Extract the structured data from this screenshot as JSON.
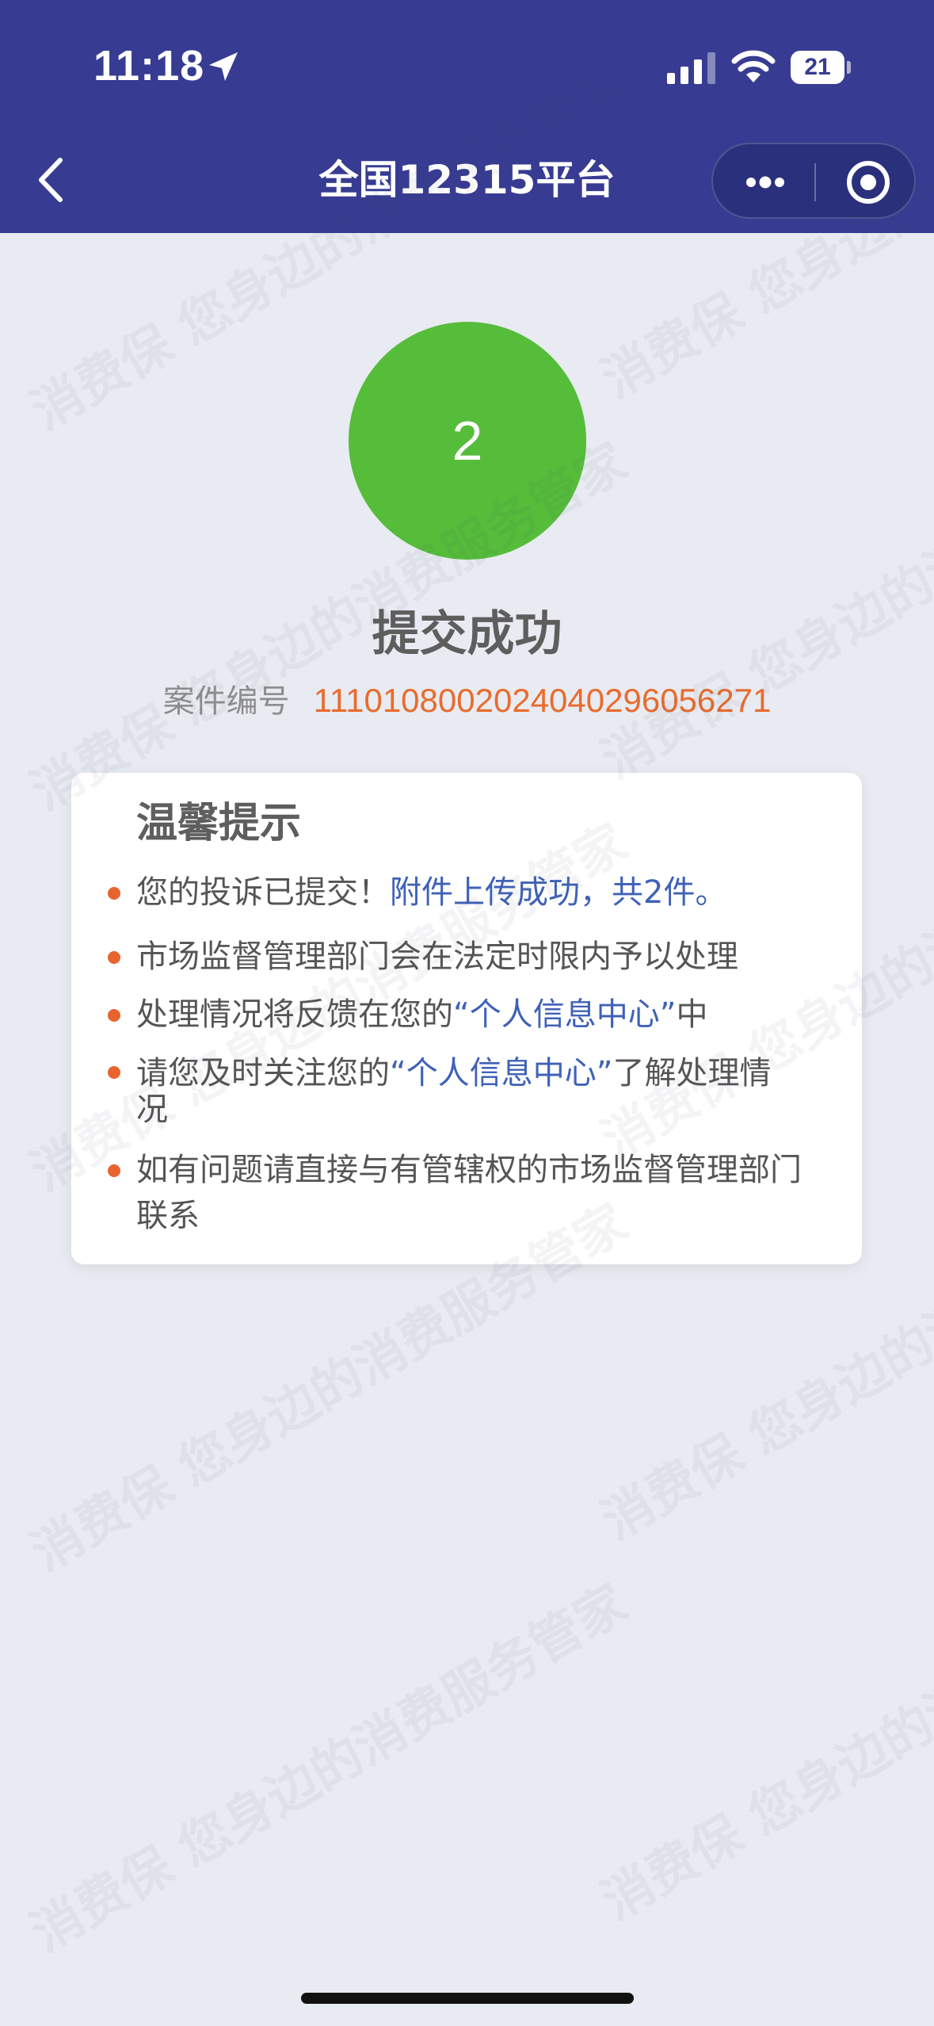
{
  "status_bar": {
    "time": "11:18",
    "battery": "21"
  },
  "nav": {
    "title": "全国12315平台"
  },
  "watermark": {
    "text": "消费保 您身边的消费服务管家"
  },
  "progress": {
    "step": "2",
    "title": "提交成功",
    "case_label": "案件编号",
    "case_number": "1110108002024040296056271"
  },
  "tips": {
    "title": "温馨提示",
    "items": [
      {
        "text": "您的投诉已提交！",
        "highlight": "附件上传成功，共2件。"
      },
      {
        "text": "市场监督管理部门会在法定时限内予以处理"
      },
      {
        "text": "处理情况将反馈在您的",
        "highlight": "“个人信息中心”",
        "suffix": "中"
      },
      {
        "text": "请您及时关注您的",
        "highlight": "“个人信息中心”",
        "suffix": "了解处理情况"
      },
      {
        "text": "如有问题请直接与有管辖权的市场监督管理部门联系"
      }
    ]
  },
  "colors": {
    "header": "#373c92",
    "success": "#56bd3b",
    "accent_orange": "#e86c2e",
    "link_blue": "#3f62b7"
  }
}
